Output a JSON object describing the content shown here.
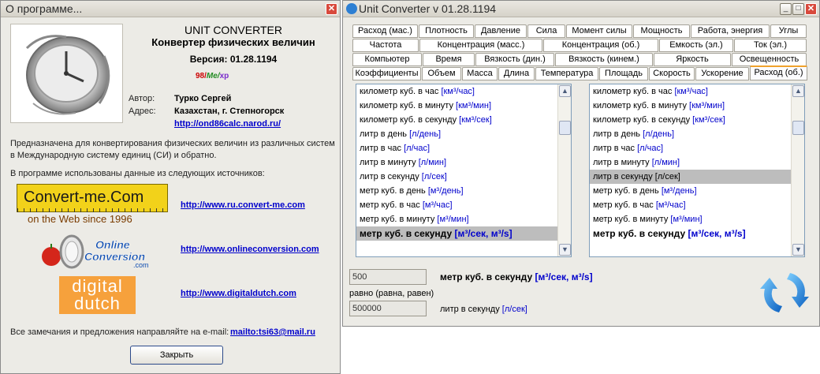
{
  "about": {
    "title": "О программе...",
    "close_x": "x",
    "app_name": "UNIT CONVERTER",
    "app_subtitle": "Конвертер физических величин",
    "version_label": "Версия: 01.28.1194",
    "os_98": "98/",
    "os_me": "Me/",
    "os_xp": "xp",
    "author_label": "Автор:",
    "author_value": "Турко Сергей",
    "address_label": "Адрес:",
    "address_value": "Казахстан, г. Степногорск",
    "site_link": "http://ond86calc.narod.ru/",
    "description": "Предназначена для конвертирования физических величин из различных систем в Международную систему единиц (СИ) и обратно.",
    "sources_intro": "В программе использованы данные из следующих источников:",
    "logo1_text": "Convert-me.Com",
    "logo1_sub": "on the Web since 1996",
    "logo2_text_a": "Online",
    "logo2_text_b": "Conversion",
    "logo2_text_c": ".com",
    "logo3_text_a": "digital",
    "logo3_text_b": "dutch",
    "source_links": [
      "http://www.ru.convert-me.com",
      "http://www.onlineconversion.com",
      "http://www.digitaldutch.com"
    ],
    "feedback_text": "Все замечания и предложения направляйте на e-mail:",
    "email_link": "mailto:tsi63@mail.ru",
    "close_button": "Закрыть"
  },
  "converter": {
    "title": "Unit Converter v 01.28.1194",
    "tabs_row1": [
      "Расход (мас.)",
      "Плотность",
      "Давление",
      "Сила",
      "Момент силы",
      "Мощность",
      "Работа, энергия",
      "Углы"
    ],
    "tabs_row2": [
      "Частота",
      "Концентрация (масс.)",
      "Концентрация (об.)",
      "Емкость (эл.)",
      "Ток (эл.)"
    ],
    "tabs_row3": [
      "Компьютер",
      "Время",
      "Вязкость (дин.)",
      "Вязкость (кинем.)",
      "Яркость",
      "Освещенность"
    ],
    "tabs_row4": [
      "Коэффициенты",
      "Объем",
      "Масса",
      "Длина",
      "Температура",
      "Площадь",
      "Скорость",
      "Ускорение",
      "Расход (об.)"
    ],
    "list_left": [
      {
        "name": "километр куб. в час",
        "unit": "[км³/час]"
      },
      {
        "name": "километр куб. в минуту",
        "unit": "[км³/мин]"
      },
      {
        "name": "километр куб. в секунду",
        "unit": "[км³/сек]"
      },
      {
        "name": "литр в день",
        "unit": "[л/день]"
      },
      {
        "name": "литр в час",
        "unit": "[л/час]"
      },
      {
        "name": "литр в минуту",
        "unit": "[л/мин]"
      },
      {
        "name": "литр в секунду",
        "unit": "[л/сек]"
      },
      {
        "name": "метр куб. в день",
        "unit": "[м³/день]"
      },
      {
        "name": "метр куб. в час",
        "unit": "[м³/час]"
      },
      {
        "name": "метр куб. в минуту",
        "unit": "[м³/мин]"
      },
      {
        "name": "метр куб. в секунду",
        "unit": "[м³/сек, м³/s]"
      }
    ],
    "list_right": [
      {
        "name": "километр куб. в час",
        "unit": "[км³/час]"
      },
      {
        "name": "километр куб. в минуту",
        "unit": "[км³/мин]"
      },
      {
        "name": "километр куб. в секунду",
        "unit": "[км³/сек]"
      },
      {
        "name": "литр в день",
        "unit": "[л/день]"
      },
      {
        "name": "литр в час",
        "unit": "[л/час]"
      },
      {
        "name": "литр в минуту",
        "unit": "[л/мин]"
      },
      {
        "name": "литр в секунду",
        "unit": "[л/сек]"
      },
      {
        "name": "метр куб. в день",
        "unit": "[м³/день]"
      },
      {
        "name": "метр куб. в час",
        "unit": "[м³/час]"
      },
      {
        "name": "метр куб. в минуту",
        "unit": "[м³/мин]"
      },
      {
        "name": "метр куб. в секунду",
        "unit": "[м³/сек, м³/s]"
      }
    ],
    "input_value": "500",
    "input_unit_name": "метр куб. в секунду",
    "input_unit": "[м³/сек, м³/s]",
    "equals_label": "равно (равна, равен)",
    "output_value": "500000",
    "output_unit_name": "литр в секунду",
    "output_unit": "[л/сек]"
  }
}
